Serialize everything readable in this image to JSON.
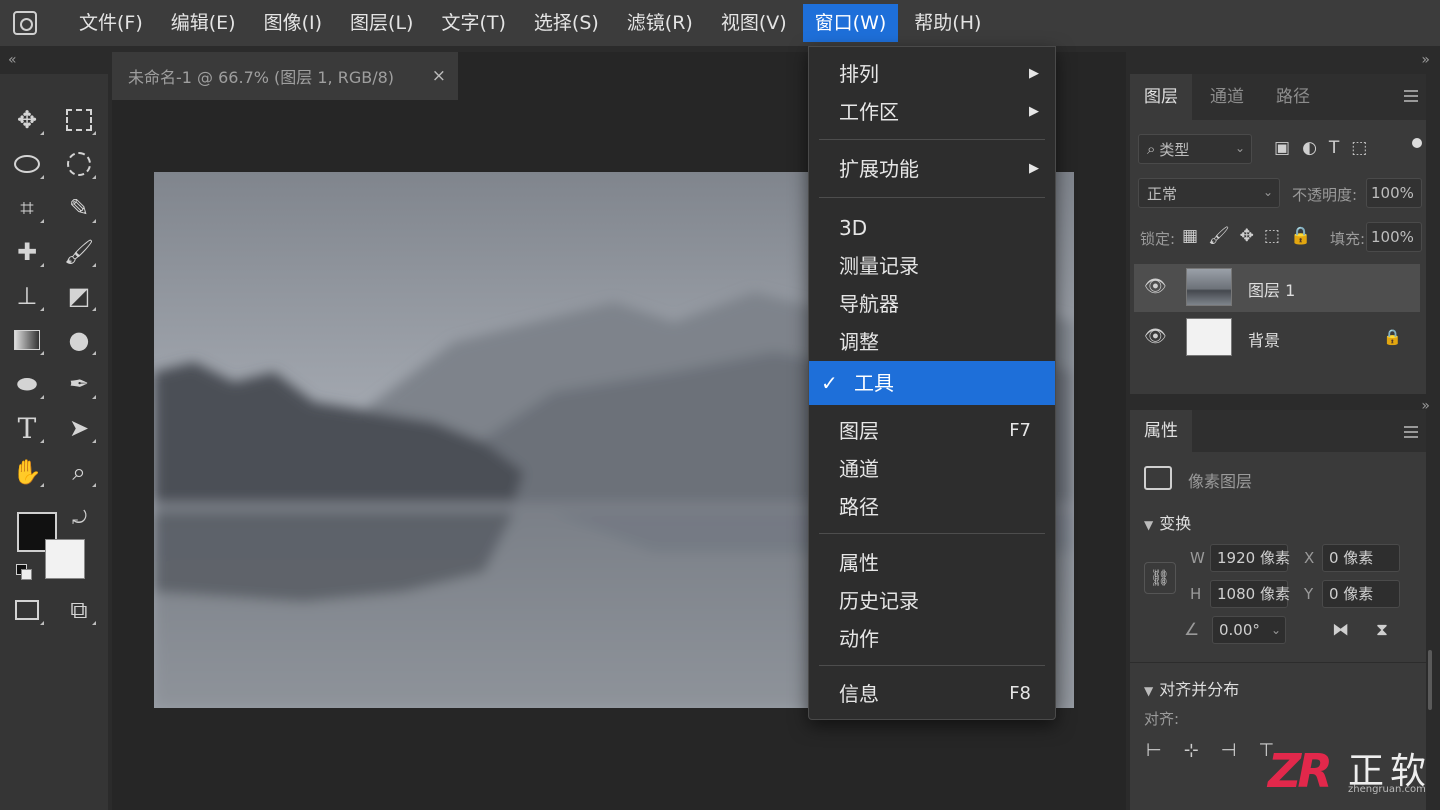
{
  "menubar": {
    "items": [
      "文件(F)",
      "编辑(E)",
      "图像(I)",
      "图层(L)",
      "文字(T)",
      "选择(S)",
      "滤镜(R)",
      "视图(V)",
      "窗口(W)",
      "帮助(H)"
    ],
    "active_index": 8
  },
  "panel_collapse": {
    "left": "«",
    "right": "»"
  },
  "document": {
    "tab_title": "未命名-1 @ 66.7% (图层 1, RGB/8)",
    "close_glyph": "×"
  },
  "toolbar": {
    "tools": [
      "move-icon",
      "marquee-icon",
      "lasso-icon",
      "quick-select-icon",
      "crop-icon",
      "eyedropper-icon",
      "healing-icon",
      "brush-icon",
      "stamp-icon",
      "eraser-icon",
      "gradient-icon",
      "blur-icon",
      "dodge-icon",
      "pen-icon",
      "type-icon",
      "path-select-icon",
      "hand-icon",
      "zoom-icon"
    ],
    "foreground_color": "#111111",
    "background_color": "#f2f2f2"
  },
  "window_menu": {
    "items": [
      {
        "label": "排列",
        "submenu": true
      },
      {
        "label": "工作区",
        "submenu": true
      },
      {
        "label": "扩展功能",
        "submenu": true
      },
      {
        "label": "3D"
      },
      {
        "label": "测量记录"
      },
      {
        "label": "导航器"
      },
      {
        "label": "调整"
      },
      {
        "label": "工具",
        "checked": true
      },
      {
        "label": "图层",
        "shortcut": "F7"
      },
      {
        "label": "通道"
      },
      {
        "label": "路径"
      },
      {
        "label": "属性"
      },
      {
        "label": "历史记录"
      },
      {
        "label": "动作"
      },
      {
        "label": "信息",
        "shortcut": "F8"
      }
    ],
    "check_glyph": "✓",
    "submenu_glyph": "▶",
    "highlight_color": "#1e6fd9"
  },
  "layers_panel": {
    "tabs": [
      "图层",
      "通道",
      "路径"
    ],
    "active_tab": 0,
    "filter_label": "类型",
    "blend_mode": "正常",
    "opacity_label": "不透明度:",
    "opacity_value": "100%",
    "lock_label": "锁定:",
    "fill_label": "填充:",
    "fill_value": "100%",
    "layers": [
      {
        "name": "图层 1",
        "selected": true,
        "locked": false
      },
      {
        "name": "背景",
        "selected": false,
        "locked": true
      }
    ]
  },
  "properties_panel": {
    "tab": "属性",
    "type_label": "像素图层",
    "transform_header": "变换",
    "w_label": "W",
    "w_value": "1920 像素",
    "x_label": "X",
    "x_value": "0 像素",
    "h_label": "H",
    "h_value": "1080 像素",
    "y_label": "Y",
    "y_value": "0 像素",
    "angle_value": "0.00°",
    "align_header": "对齐并分布",
    "align_label": "对齐:"
  },
  "watermark": {
    "logo": "ZR",
    "text": "正软",
    "url": "zhengruan.com"
  }
}
